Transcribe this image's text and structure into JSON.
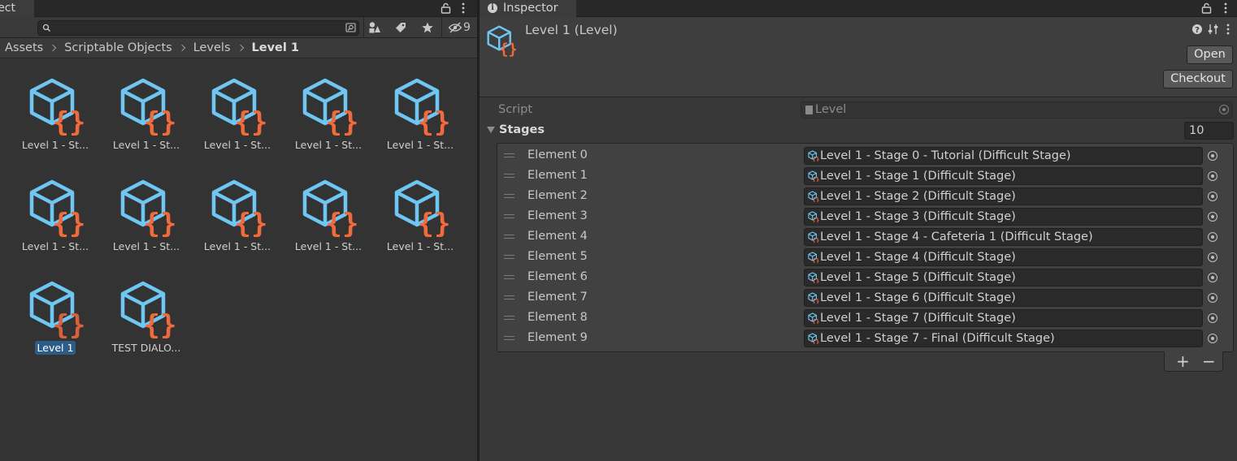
{
  "project": {
    "tab_label": "Project",
    "search": {
      "value": "",
      "placeholder": ""
    },
    "hidden_count": "9",
    "breadcrumb": [
      "Assets",
      "Scriptable Objects",
      "Levels",
      "Level 1"
    ],
    "assets": [
      {
        "label": "Level 1 - St..."
      },
      {
        "label": "Level 1 - St..."
      },
      {
        "label": "Level 1 - St..."
      },
      {
        "label": "Level 1 - St..."
      },
      {
        "label": "Level 1 - St..."
      },
      {
        "label": "Level 1 - St..."
      },
      {
        "label": "Level 1 - St..."
      },
      {
        "label": "Level 1 - St..."
      },
      {
        "label": "Level 1 - St..."
      },
      {
        "label": "Level 1 - St..."
      },
      {
        "label": "Level 1",
        "selected": true
      },
      {
        "label": "TEST DIALO..."
      }
    ]
  },
  "inspector": {
    "tab_label": "Inspector",
    "title": "Level 1 (Level)",
    "open_label": "Open",
    "checkout_label": "Checkout",
    "script_label": "Script",
    "script_value": "Level",
    "stages_label": "Stages",
    "stages_size": "10",
    "elements": [
      {
        "label": "Element 0",
        "value": "Level 1 - Stage 0 - Tutorial (Difficult Stage)"
      },
      {
        "label": "Element 1",
        "value": "Level 1 - Stage 1 (Difficult Stage)"
      },
      {
        "label": "Element 2",
        "value": "Level 1 - Stage 2 (Difficult Stage)"
      },
      {
        "label": "Element 3",
        "value": "Level 1 - Stage 3 (Difficult Stage)"
      },
      {
        "label": "Element 4",
        "value": "Level 1 - Stage 4 - Cafeteria 1 (Difficult Stage)"
      },
      {
        "label": "Element 5",
        "value": "Level 1 - Stage 4 (Difficult Stage)"
      },
      {
        "label": "Element 6",
        "value": "Level 1 - Stage 5 (Difficult Stage)"
      },
      {
        "label": "Element 7",
        "value": "Level 1 - Stage 6 (Difficult Stage)"
      },
      {
        "label": "Element 8",
        "value": "Level 1 - Stage 7 (Difficult Stage)"
      },
      {
        "label": "Element 9",
        "value": "Level 1 - Stage 7 - Final (Difficult Stage)"
      }
    ],
    "add_label": "+",
    "remove_label": "−"
  },
  "colors": {
    "cube": "#6ec6f2",
    "braces": "#f26a3c",
    "braces_selected": "#d9603a",
    "selection": "#2c5d87"
  }
}
